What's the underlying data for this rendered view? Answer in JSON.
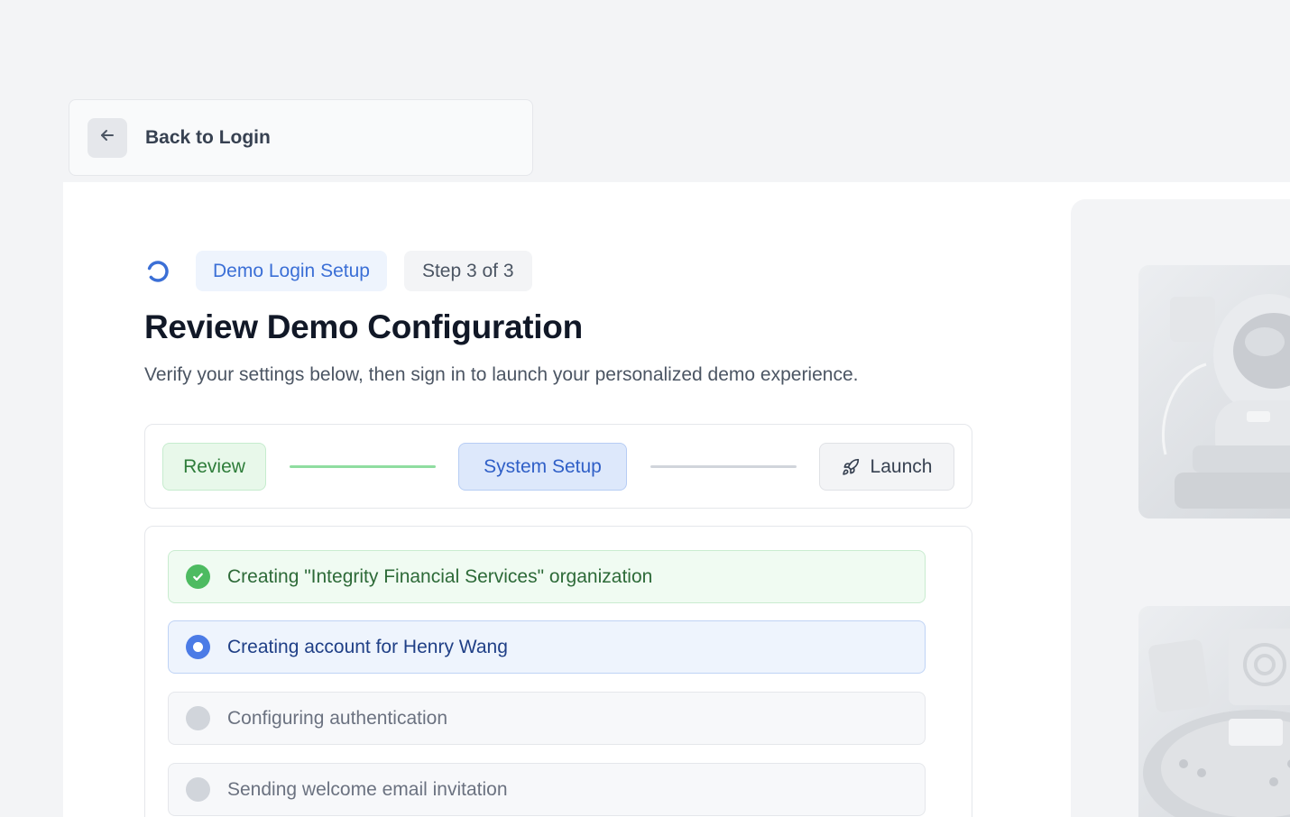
{
  "back": {
    "icon": "arrow-left-icon",
    "label": "Back to Login"
  },
  "header": {
    "icon": "loading-spinner-icon",
    "badge": "Demo Login Setup",
    "step_badge": "Step 3 of 3",
    "title": "Review Demo Configuration",
    "subtitle": "Verify your settings below, then sign in to launch your personalized demo experience."
  },
  "stepper": {
    "steps": [
      {
        "label": "Review",
        "state": "complete"
      },
      {
        "label": "System Setup",
        "state": "active"
      },
      {
        "label": "Launch",
        "state": "pending",
        "icon": "rocket-icon"
      }
    ]
  },
  "tasks": [
    {
      "label": "Creating \"Integrity Financial Services\" organization",
      "state": "done",
      "icon": "check-circle-icon"
    },
    {
      "label": "Creating account for Henry Wang",
      "state": "in-progress",
      "icon": "progress-dot-icon"
    },
    {
      "label": "Configuring authentication",
      "state": "pending",
      "icon": "pending-dot-icon"
    },
    {
      "label": "Sending welcome email invitation",
      "state": "pending",
      "icon": "pending-dot-icon"
    }
  ],
  "side_panel": {
    "illustrations": [
      "astronaut-illustration",
      "dashboard-illustration"
    ]
  },
  "colors": {
    "accent_blue": "#3b6fd6",
    "success_green": "#4dbb61",
    "pending_gray": "#d1d5db"
  }
}
